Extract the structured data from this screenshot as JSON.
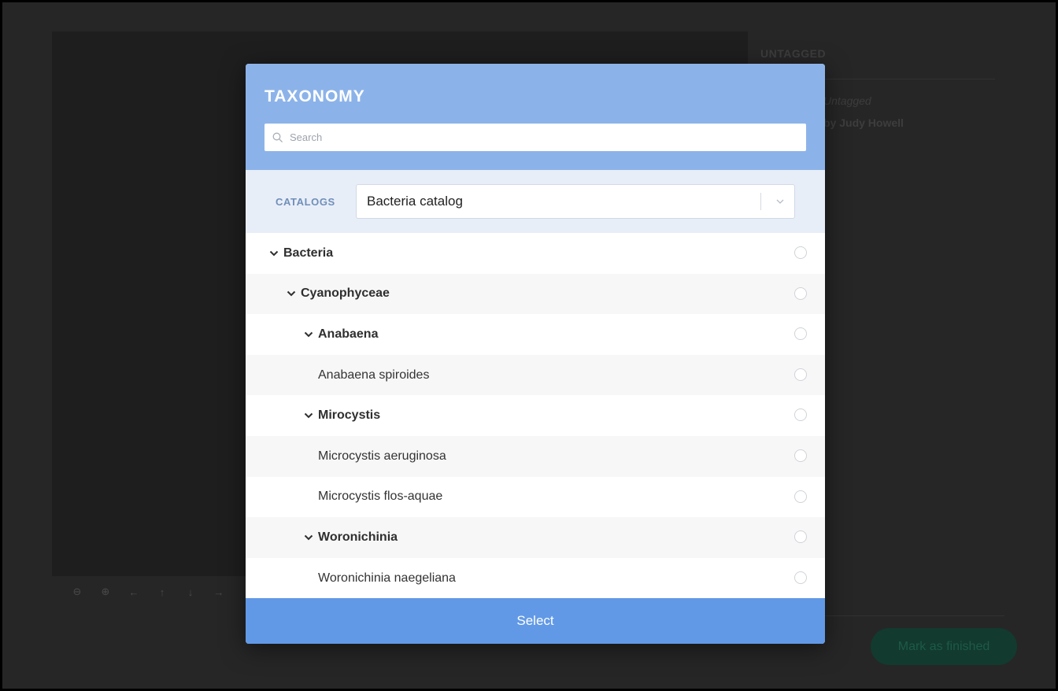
{
  "background": {
    "panel_title": "UNTAGGED",
    "status_text": "Untagged",
    "author_text": "by Judy Howell",
    "finish_button": "Mark as finished",
    "toolbar_icons": [
      "zoom-out-icon",
      "zoom-in-icon",
      "arrow-left-icon",
      "arrow-up-icon",
      "arrow-down-icon",
      "arrow-right-icon"
    ]
  },
  "modal": {
    "title": "TAXONOMY",
    "search": {
      "placeholder": "Search",
      "value": ""
    },
    "catalogs": {
      "label": "CATALOGS",
      "selected": "Bacteria catalog"
    },
    "tree": [
      {
        "label": "Bacteria",
        "level": 0,
        "group": true,
        "expanded": true,
        "checked": false
      },
      {
        "label": "Cyanophyceae",
        "level": 1,
        "group": true,
        "expanded": true,
        "checked": false
      },
      {
        "label": "Anabaena",
        "level": 2,
        "group": true,
        "expanded": true,
        "checked": false
      },
      {
        "label": "Anabaena spiroides",
        "level": 3,
        "group": false,
        "checked": false
      },
      {
        "label": "Mirocystis",
        "level": 2,
        "group": true,
        "expanded": true,
        "checked": false
      },
      {
        "label": "Microcystis aeruginosa",
        "level": 3,
        "group": false,
        "checked": false
      },
      {
        "label": "Microcystis flos-aquae",
        "level": 3,
        "group": false,
        "checked": false
      },
      {
        "label": "Woronichinia",
        "level": 2,
        "group": true,
        "expanded": true,
        "checked": false
      },
      {
        "label": "Woronichinia naegeliana",
        "level": 3,
        "group": false,
        "checked": false
      }
    ],
    "select_button": "Select"
  },
  "colors": {
    "header_bg": "#8cb3e9",
    "catalog_bg": "#e8eef8",
    "select_button_bg": "#6199e6",
    "backdrop": "#262626"
  }
}
